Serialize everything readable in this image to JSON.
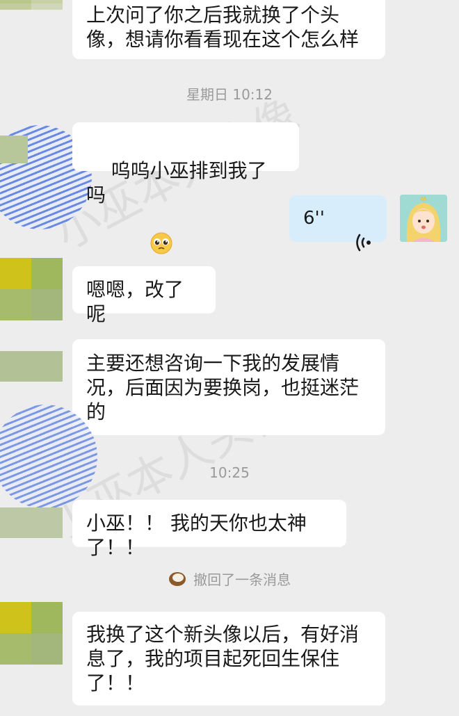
{
  "messages": [
    {
      "text": "上次问了你之后我就换了个头\n像，想请你看看现在这个怎么样"
    },
    {
      "text": "呜呜小巫排到我了吗"
    },
    {
      "text": "嗯嗯，改了呢"
    },
    {
      "text": "主要还想咨询一下我的发展情\n况，后面因为要换岗，也挺迷茫\n的"
    },
    {
      "text": "小巫！！ 我的天你也太神了！！"
    },
    {
      "text": "我换了这个新头像以后，有好消\n息了，我的项目起死回生保住\n了！！"
    }
  ],
  "timestamps": [
    "星期日 10:12",
    "10:25"
  ],
  "voice_message": {
    "duration": "6''",
    "icon": "voice-wave-icon"
  },
  "recall_notice": {
    "text": "撤回了一条消息",
    "icon": "coconut-icon"
  },
  "watermark": {
    "text": "小巫本人头像"
  },
  "emoji": {
    "name": "pleading-face-emoji"
  },
  "colors": {
    "background": "#ededed",
    "bubble": "#ffffff",
    "my_bubble": "#d7edfb",
    "timestamp": "#9a9a9a"
  }
}
